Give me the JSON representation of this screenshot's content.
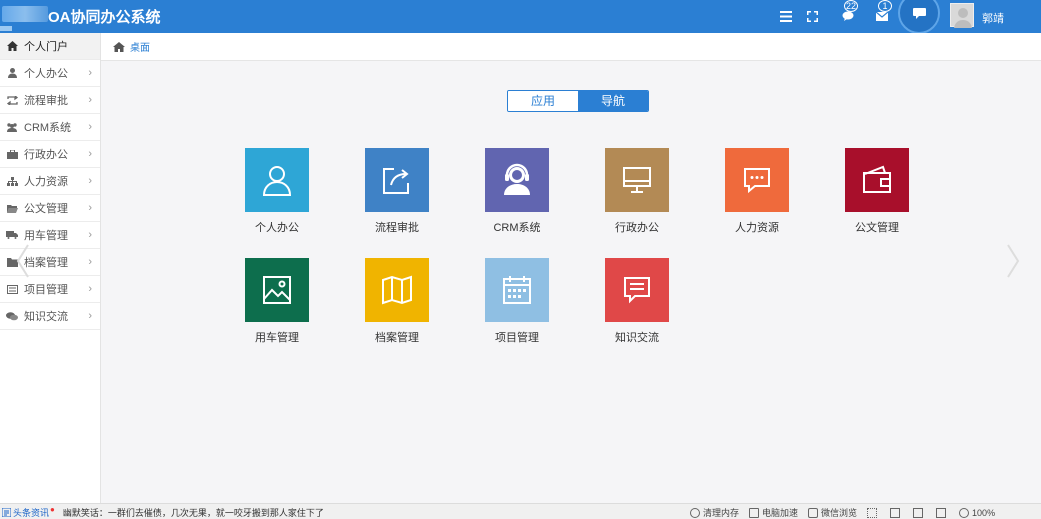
{
  "header": {
    "title": "OA协同办公系统",
    "badge_chat": "22",
    "badge_mail": "1",
    "username": "郭靖"
  },
  "sidebar": {
    "items": [
      {
        "label": "个人门户",
        "icon": "home-icon",
        "active": true
      },
      {
        "label": "个人办公",
        "icon": "user-icon"
      },
      {
        "label": "流程审批",
        "icon": "retweet-icon"
      },
      {
        "label": "CRM系统",
        "icon": "group-icon"
      },
      {
        "label": "行政办公",
        "icon": "briefcase-icon"
      },
      {
        "label": "人力资源",
        "icon": "org-chart-icon"
      },
      {
        "label": "公文管理",
        "icon": "folder-open-icon"
      },
      {
        "label": "用车管理",
        "icon": "truck-icon"
      },
      {
        "label": "档案管理",
        "icon": "folder-icon"
      },
      {
        "label": "项目管理",
        "icon": "list-box-icon"
      },
      {
        "label": "知识交流",
        "icon": "comments-icon"
      }
    ]
  },
  "breadcrumb": {
    "label": "桌面"
  },
  "toggle": {
    "app": "应用",
    "nav": "导航",
    "active": "nav"
  },
  "tiles": [
    {
      "label": "个人办公",
      "color": "#2ea6d6",
      "icon": "person-icon"
    },
    {
      "label": "流程审批",
      "color": "#3f82c6",
      "icon": "share-box-icon"
    },
    {
      "label": "CRM系统",
      "color": "#6165b0",
      "icon": "customer-service-icon"
    },
    {
      "label": "行政办公",
      "color": "#b38a55",
      "icon": "monitor-icon"
    },
    {
      "label": "人力资源",
      "color": "#ef6a3c",
      "icon": "message-icon"
    },
    {
      "label": "公文管理",
      "color": "#a80f2b",
      "icon": "wallet-icon"
    },
    {
      "label": "用车管理",
      "color": "#0d6e4d",
      "icon": "image-icon"
    },
    {
      "label": "档案管理",
      "color": "#f0b400",
      "icon": "map-icon"
    },
    {
      "label": "项目管理",
      "color": "#8fbfe3",
      "icon": "calendar-icon"
    },
    {
      "label": "知识交流",
      "color": "#e04848",
      "icon": "note-icon"
    }
  ],
  "taskbar": {
    "news_label": "头条资讯",
    "news_text": "幽默笑话：一群们去催债，几次无果，就一咬牙搬到那人家住下了",
    "items": [
      "清理内存",
      "电脑加速",
      "微信浏览",
      "",
      "",
      "",
      "",
      "100%"
    ]
  }
}
